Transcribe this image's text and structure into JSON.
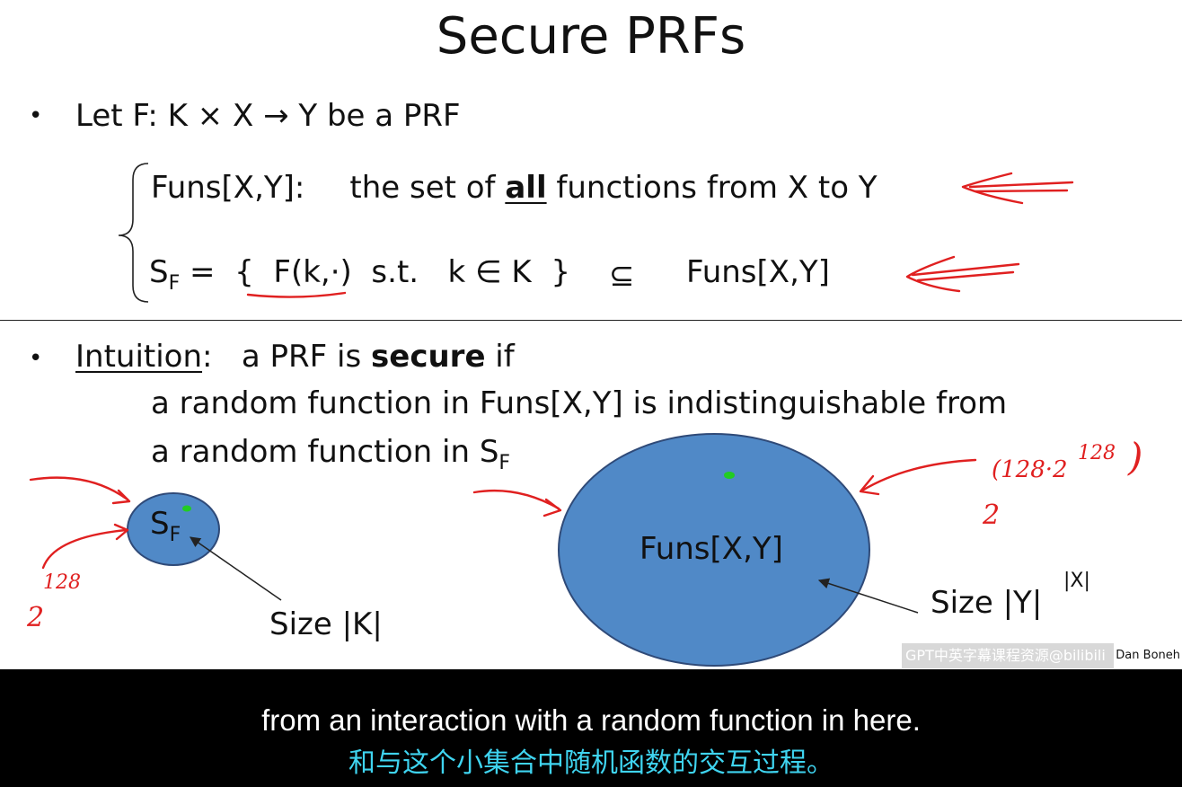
{
  "slide": {
    "title": "Secure PRFs",
    "bullet_symbol": "•",
    "line1": "Let   F:  K × X  →  Y   be a PRF",
    "line2_prefix": "Funs[X,Y]:",
    "line2_text_a": "the set of ",
    "line2_bold": "all",
    "line2_text_b": " functions from X to Y",
    "line3_s": "S",
    "line3_sub": "F",
    "line3_eq": " =  {  ",
    "line3_fk": "F(k,·)",
    "line3_rest": "  s.t.   k ∈ K  }",
    "line3_subset": "⊆",
    "line3_funs": "Funs[X,Y]",
    "intuition_label": "Intuition",
    "intuition_a": ":   a PRF is ",
    "intuition_bold": "secure",
    "intuition_b": " if",
    "intuition_line2": "a random function in Funs[X,Y] is indistinguishable from",
    "intuition_line3": "a random function in S",
    "intuition_line3_sub": "F",
    "small_set_label": "S",
    "small_set_sub": "F",
    "small_set_size": "Size |K|",
    "big_set_label": "Funs[X,Y]",
    "big_set_size": "Size |Y|",
    "big_set_size_exp": "|X|",
    "author": "Dan Boneh"
  },
  "handwriting": {
    "small_base": "2",
    "small_exp": "128",
    "big_base": "2",
    "big_exp": "(128·2",
    "big_exp_exp": "128",
    "big_close": ")"
  },
  "watermark": "GPT中英字幕课程资源@bilibili",
  "subtitles": {
    "english": "from an interaction with a random function in here.",
    "chinese": "和与这个小集合中随机函数的交互过程。"
  },
  "colors": {
    "ellipse_fill": "#5089c7",
    "ink": "#e02020",
    "subtitle_zh": "#3fd4f0"
  }
}
